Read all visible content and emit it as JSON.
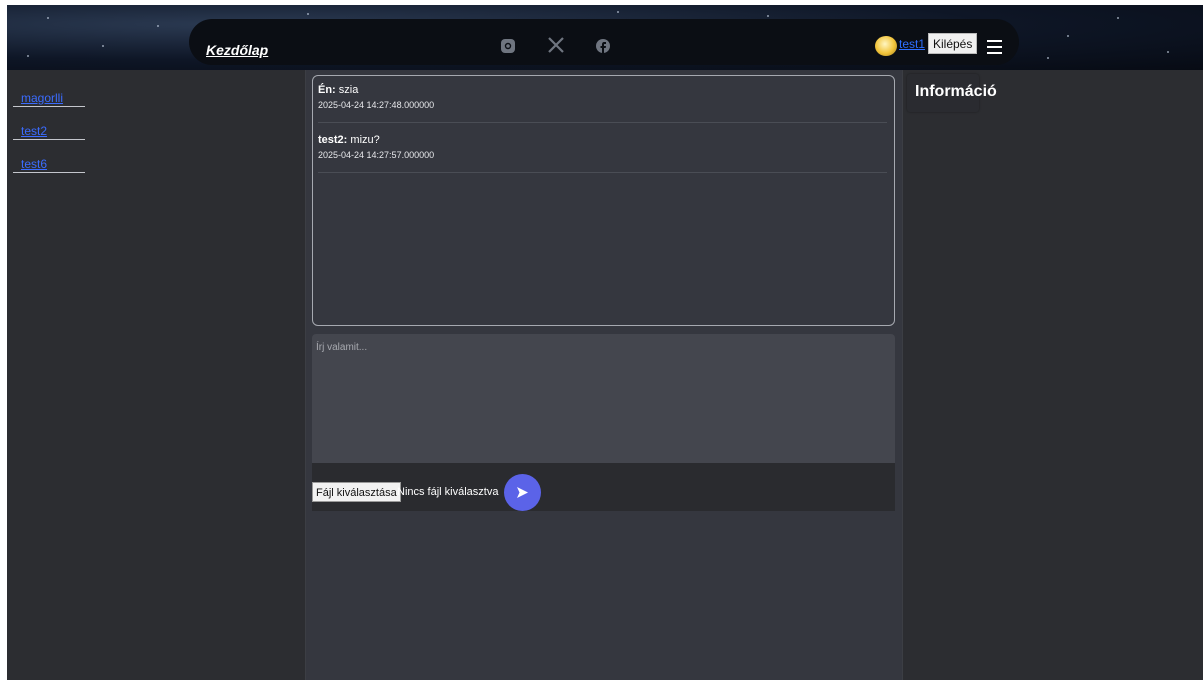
{
  "header": {
    "home_label": "Kezdőlap",
    "social_icons": [
      "instagram-icon",
      "x-icon",
      "facebook-icon"
    ],
    "user_link": "test1",
    "logout_label": "Kilépés"
  },
  "sidebar": {
    "contacts": [
      {
        "label": "magorlli"
      },
      {
        "label": "test2"
      },
      {
        "label": "test6"
      }
    ]
  },
  "chat": {
    "messages": [
      {
        "sender": "Én:",
        "text": " szia",
        "timestamp": "2025-04-24 14:27:48.000000"
      },
      {
        "sender": "test2:",
        "text": " mizu?",
        "timestamp": "2025-04-24 14:27:57.000000"
      }
    ],
    "composer_placeholder": "Írj valamit...",
    "file_button_label": "Fájl kiválasztása",
    "file_status": "Nincs fájl kiválasztva"
  },
  "info_panel": {
    "title": "Információ"
  },
  "colors": {
    "accent": "#5b63e8",
    "link": "#3b6cff",
    "panel_bg": "#2c2d31",
    "main_bg": "#35373f"
  }
}
